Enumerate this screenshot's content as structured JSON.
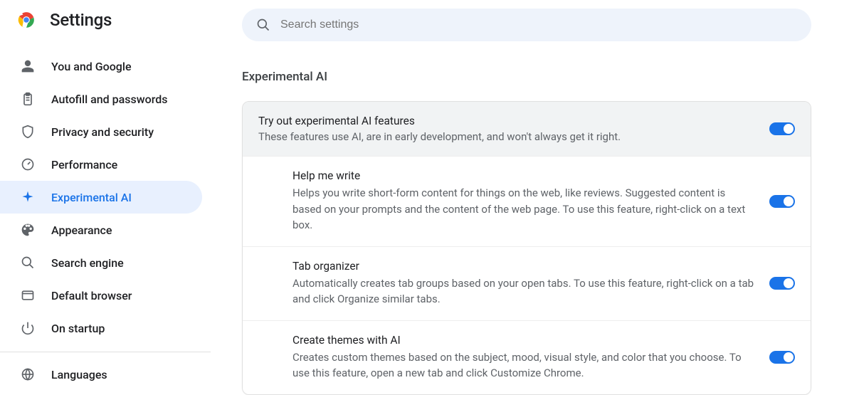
{
  "brand": {
    "title": "Settings"
  },
  "search": {
    "placeholder": "Search settings"
  },
  "sidebar": {
    "items": [
      {
        "label": "You and Google"
      },
      {
        "label": "Autofill and passwords"
      },
      {
        "label": "Privacy and security"
      },
      {
        "label": "Performance"
      },
      {
        "label": "Experimental AI"
      },
      {
        "label": "Appearance"
      },
      {
        "label": "Search engine"
      },
      {
        "label": "Default browser"
      },
      {
        "label": "On startup"
      },
      {
        "label": "Languages"
      }
    ]
  },
  "page": {
    "title": "Experimental AI",
    "header": {
      "title": "Try out experimental AI features",
      "desc": "These features use AI, are in early development, and won't always get it right."
    },
    "rows": [
      {
        "title": "Help me write",
        "desc": "Helps you write short-form content for things on the web, like reviews. Suggested content is based on your prompts and the content of the web page. To use this feature, right-click on a text box."
      },
      {
        "title": "Tab organizer",
        "desc": "Automatically creates tab groups based on your open tabs. To use this feature, right-click on a tab and click Organize similar tabs."
      },
      {
        "title": "Create themes with AI",
        "desc": "Creates custom themes based on the subject, mood, visual style, and color that you choose. To use this feature, open a new tab and click Customize Chrome."
      }
    ]
  }
}
